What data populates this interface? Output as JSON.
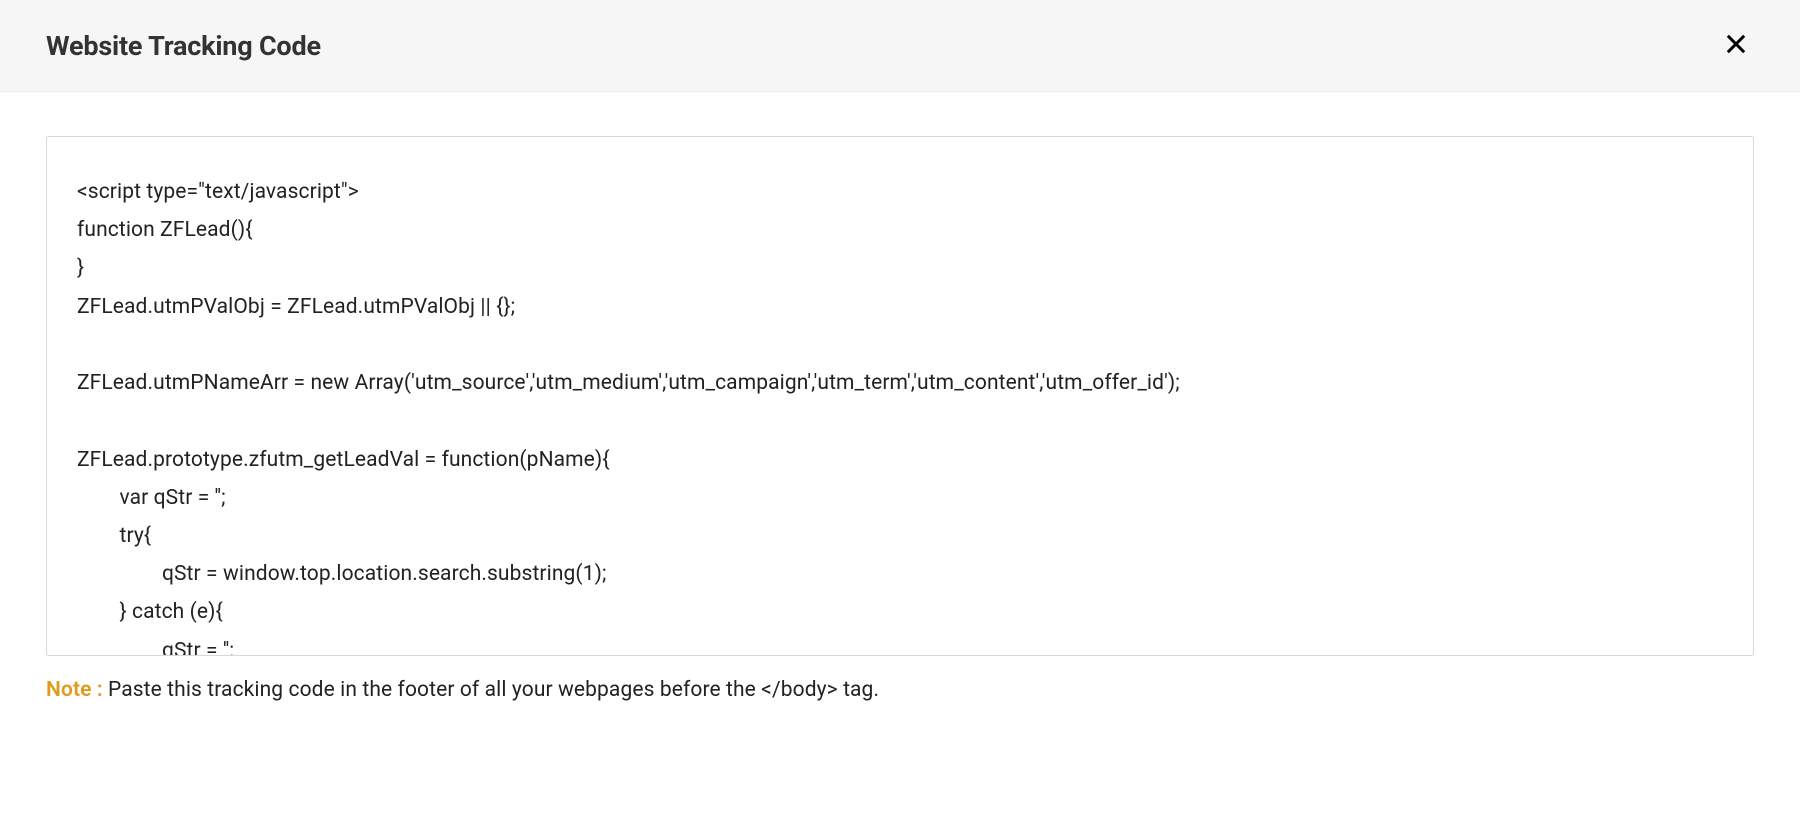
{
  "header": {
    "title": "Website Tracking Code"
  },
  "code": {
    "lines": [
      "<script type=\"text/javascript\">",
      "function ZFLead(){",
      "}",
      "ZFLead.utmPValObj = ZFLead.utmPValObj || {};",
      "",
      "ZFLead.utmPNameArr = new Array('utm_source','utm_medium','utm_campaign','utm_term','utm_content','utm_offer_id');",
      "",
      "ZFLead.prototype.zfutm_getLeadVal = function(pName){",
      "        var qStr = '';",
      "        try{",
      "                qStr = window.top.location.search.substring(1);",
      "        } catch (e){",
      "                qStr = '';"
    ]
  },
  "note": {
    "label": "Note : ",
    "text": "Paste this tracking code in the footer of all your webpages before the </body> tag."
  }
}
